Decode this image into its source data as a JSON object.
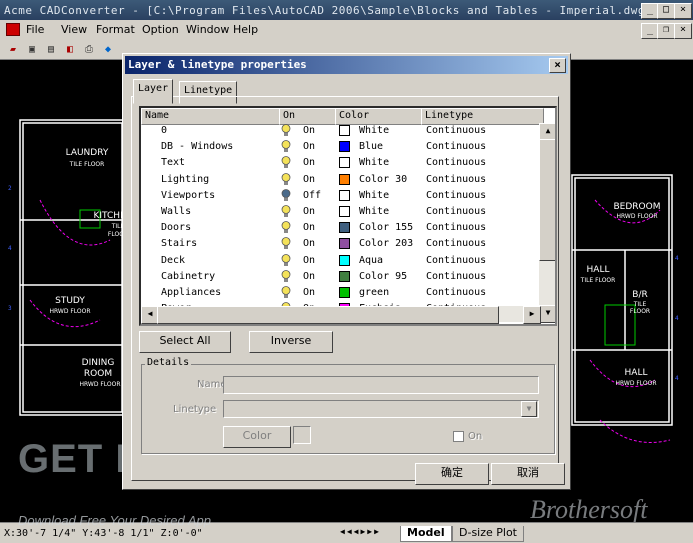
{
  "window": {
    "title": "Acme CADConverter - [C:\\Program Files\\AutoCAD 2006\\Sample\\Blocks and Tables - Imperial.dwg]"
  },
  "menu": [
    "File",
    "View",
    "Format",
    "Option",
    "Window",
    "Help"
  ],
  "drawing": {
    "rooms": [
      "LAUNDRY",
      "TILE FLOOR",
      "KITCHEN",
      "TILE",
      "FLOOR",
      "STUDY",
      "HRWD FLOOR",
      "DINING",
      "ROOM",
      "HRWD FLOOR",
      "BEDROOM",
      "HRWD FLOOR",
      "HALL",
      "TILE FLOOR",
      "B/R",
      "TILE",
      "FLOOR",
      "HALL",
      "HRWD FLOOR"
    ]
  },
  "status": {
    "coords": "X:30'-7 1/4\" Y:43'-8 1/1\" Z:0'-0\"",
    "tabs": [
      "Model",
      "D-size Plot"
    ]
  },
  "dialog": {
    "title": "Layer & linetype properties",
    "tabs": [
      "Layer",
      "Linetype"
    ],
    "columns": [
      "Name",
      "On",
      "Color",
      "Linetype"
    ],
    "layers": [
      {
        "name": "0",
        "on": "On",
        "color": "White",
        "swatch": "#ffffff",
        "bulb": "#f4e25a",
        "linetype": "Continuous"
      },
      {
        "name": "DB - Windows",
        "on": "On",
        "color": "Blue",
        "swatch": "#0000ff",
        "bulb": "#f4e25a",
        "linetype": "Continuous"
      },
      {
        "name": "Text",
        "on": "On",
        "color": "White",
        "swatch": "#ffffff",
        "bulb": "#f4e25a",
        "linetype": "Continuous"
      },
      {
        "name": "Lighting",
        "on": "On",
        "color": "Color 30",
        "swatch": "#ff7f00",
        "bulb": "#f4e25a",
        "linetype": "Continuous"
      },
      {
        "name": "Viewports",
        "on": "Off",
        "color": "White",
        "swatch": "#ffffff",
        "bulb": "#4a6a8a",
        "linetype": "Continuous"
      },
      {
        "name": "Walls",
        "on": "On",
        "color": "White",
        "swatch": "#ffffff",
        "bulb": "#f4e25a",
        "linetype": "Continuous"
      },
      {
        "name": "Doors",
        "on": "On",
        "color": "Color 155",
        "swatch": "#3f5f7f",
        "bulb": "#f4e25a",
        "linetype": "Continuous"
      },
      {
        "name": "Stairs",
        "on": "On",
        "color": "Color 203",
        "swatch": "#8f4fa0",
        "bulb": "#f4e25a",
        "linetype": "Continuous"
      },
      {
        "name": "Deck",
        "on": "On",
        "color": "Aqua",
        "swatch": "#00ffff",
        "bulb": "#f4e25a",
        "linetype": "Continuous"
      },
      {
        "name": "Cabinetry",
        "on": "On",
        "color": "Color 95",
        "swatch": "#3f7f3f",
        "bulb": "#f4e25a",
        "linetype": "Continuous"
      },
      {
        "name": "Appliances",
        "on": "On",
        "color": "green",
        "swatch": "#00c000",
        "bulb": "#f4e25a",
        "linetype": "Continuous"
      },
      {
        "name": "Power",
        "on": "On",
        "color": "Fuchsia",
        "swatch": "#ff00ff",
        "bulb": "#f4e25a",
        "linetype": "Continuous"
      }
    ],
    "buttons": {
      "select_all": "Select All",
      "inverse": "Inverse",
      "ok": "确定",
      "cancel": "取消"
    },
    "details": {
      "legend": "Details",
      "name_label": "Name",
      "linetype_label": "Linetype",
      "color_button": "Color",
      "on_label": "On"
    }
  },
  "watermark": {
    "logo": "GET INTO PC",
    "tagline": "Download Free Your Desired App",
    "brand": "Brothersoft"
  }
}
